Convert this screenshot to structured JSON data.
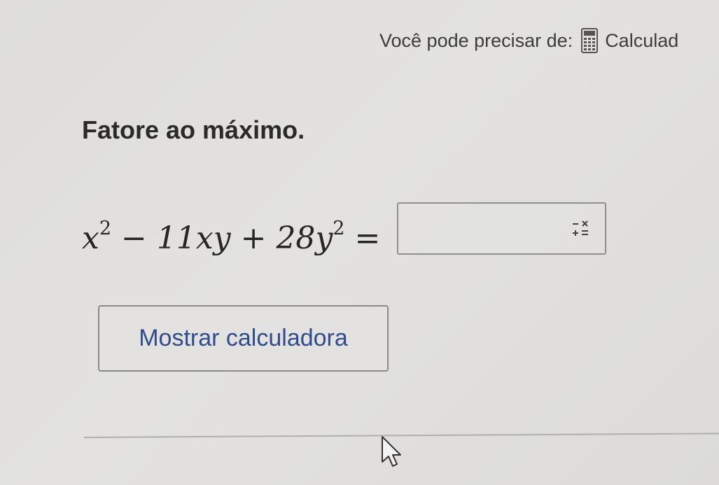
{
  "hint": {
    "prefix": "Você pode precisar de:",
    "tool_label": "Calculad",
    "icon": "calculator-icon"
  },
  "question": {
    "prompt": "Fatore ao máximo.",
    "equation": {
      "t1_var": "x",
      "t1_exp": "2",
      "op1": "−",
      "t2": "11xy",
      "op2": "+",
      "t3_coef": "28",
      "t3_var": "y",
      "t3_exp": "2",
      "equals": "="
    },
    "answer_value": "",
    "keypad_icon": "math-keypad-icon"
  },
  "actions": {
    "show_calculator_label": "Mostrar calculadora"
  },
  "colors": {
    "background": "#dfdedc",
    "button_text": "#2f4d8c",
    "text": "#2b2b2b",
    "border": "#8f8f8f"
  }
}
